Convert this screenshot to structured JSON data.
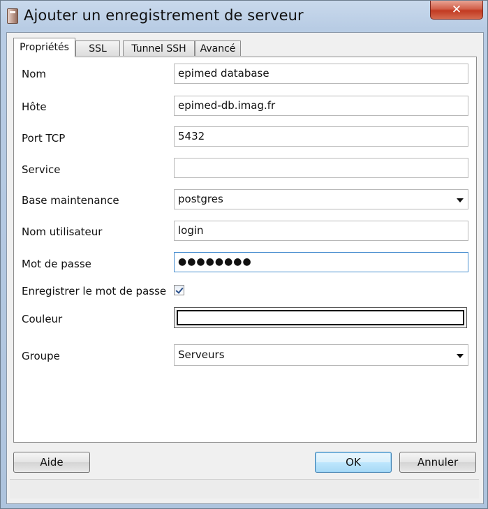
{
  "window": {
    "title": "Ajouter un enregistrement de serveur",
    "close_glyph": "✕"
  },
  "tabs": [
    {
      "label": "Propriétés",
      "active": true
    },
    {
      "label": "SSL",
      "active": false
    },
    {
      "label": "Tunnel SSH",
      "active": false
    },
    {
      "label": "Avancé",
      "active": false
    }
  ],
  "form": {
    "nom": {
      "label": "Nom",
      "value": "epimed database"
    },
    "hote": {
      "label": "Hôte",
      "value": "epimed-db.imag.fr"
    },
    "port": {
      "label": "Port TCP",
      "value": "5432"
    },
    "service": {
      "label": "Service",
      "value": ""
    },
    "base_maintenance": {
      "label": "Base maintenance",
      "value": "postgres"
    },
    "nom_utilisateur": {
      "label": "Nom utilisateur",
      "value": "login"
    },
    "mot_de_passe": {
      "label": "Mot de passe",
      "value": "●●●●●●●●"
    },
    "enregistrer": {
      "label": "Enregistrer le mot de passe",
      "checked": true
    },
    "couleur": {
      "label": "Couleur",
      "value": "#ffffff"
    },
    "groupe": {
      "label": "Groupe",
      "value": "Serveurs"
    }
  },
  "buttons": {
    "aide": "Aide",
    "ok": "OK",
    "annuler": "Annuler"
  },
  "colors": {
    "accent": "#3c7fb1",
    "titlebar": "#b8cce4",
    "close": "#c23a22"
  }
}
